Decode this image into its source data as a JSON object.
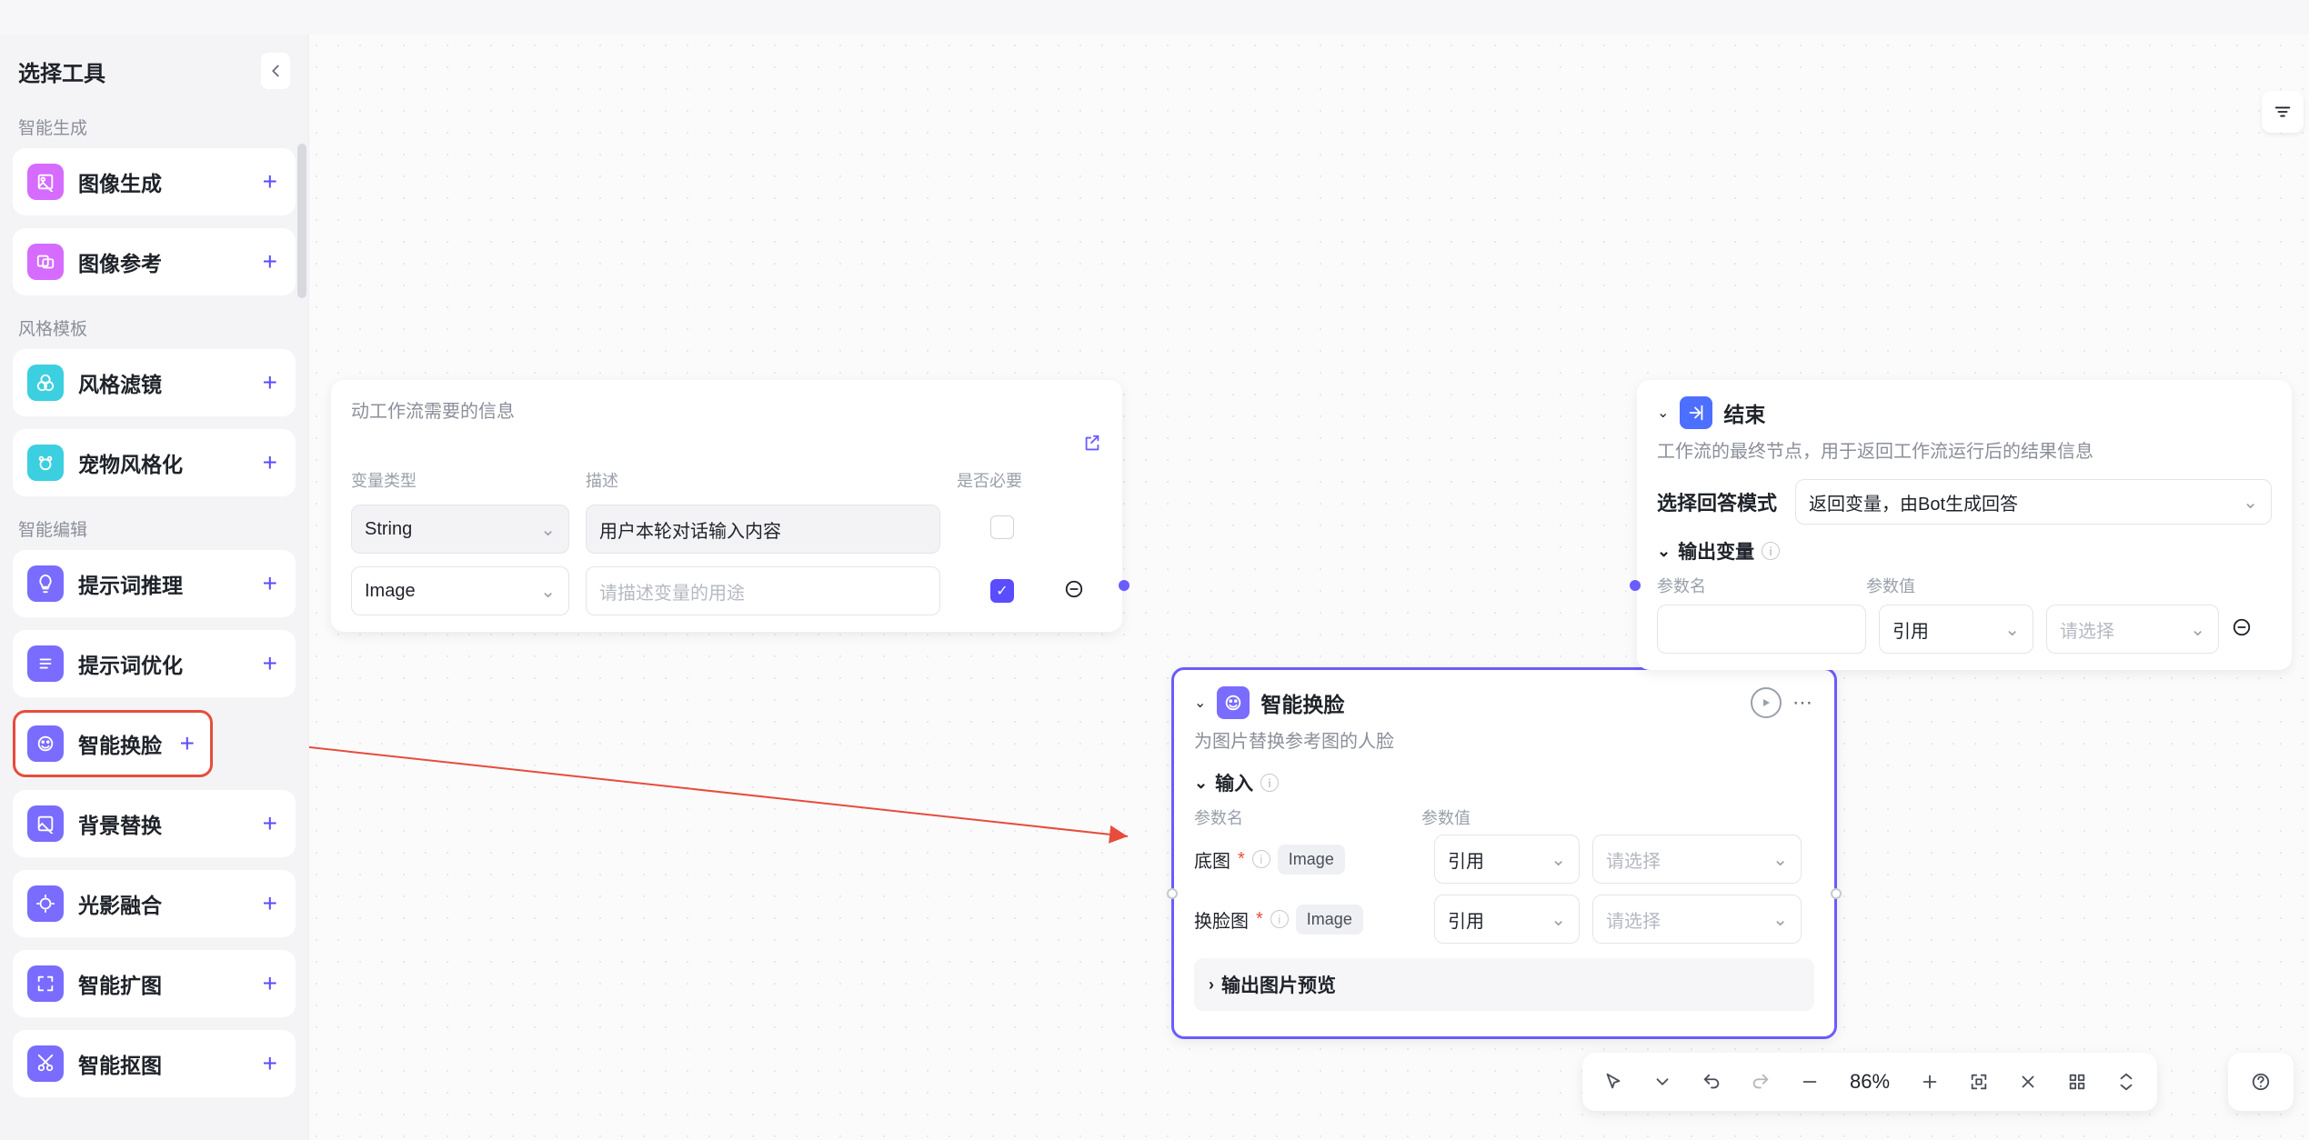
{
  "colors": {
    "accent": "#5a4cff",
    "danger": "#e74c3c"
  },
  "sidebar": {
    "title": "选择工具",
    "groups": [
      {
        "label": "智能生成",
        "items": [
          {
            "name": "image-gen",
            "label": "图像生成",
            "iconColor": "#d66bff"
          },
          {
            "name": "image-ref",
            "label": "图像参考",
            "iconColor": "#d66bff"
          }
        ]
      },
      {
        "label": "风格模板",
        "items": [
          {
            "name": "style-filter",
            "label": "风格滤镜",
            "iconColor": "#3bcfe0"
          },
          {
            "name": "pet-style",
            "label": "宠物风格化",
            "iconColor": "#3bcfe0"
          }
        ]
      },
      {
        "label": "智能编辑",
        "items": [
          {
            "name": "prompt-infer",
            "label": "提示词推理",
            "iconColor": "#7a6cff"
          },
          {
            "name": "prompt-opt",
            "label": "提示词优化",
            "iconColor": "#7a6cff"
          },
          {
            "name": "face-swap",
            "label": "智能换脸",
            "iconColor": "#7a6cff",
            "highlight": true
          },
          {
            "name": "bg-replace",
            "label": "背景替换",
            "iconColor": "#7a6cff"
          },
          {
            "name": "light-blend",
            "label": "光影融合",
            "iconColor": "#7a6cff"
          },
          {
            "name": "smart-expand",
            "label": "智能扩图",
            "iconColor": "#7a6cff"
          },
          {
            "name": "smart-cutout",
            "label": "智能抠图",
            "iconColor": "#7a6cff"
          }
        ]
      }
    ]
  },
  "startNode": {
    "desc": "动工作流需要的信息",
    "cols": {
      "type": "变量类型",
      "desc": "描述",
      "required": "是否必要"
    },
    "rows": [
      {
        "type": "String",
        "desc": "用户本轮对话输入内容",
        "required": false,
        "descIsValue": true
      },
      {
        "type": "Image",
        "descPlaceholder": "请描述变量的用途",
        "required": true
      }
    ]
  },
  "faceNode": {
    "title": "智能换脸",
    "desc": "为图片替换参考图的人脸",
    "inputSection": "输入",
    "cols": {
      "name": "参数名",
      "value": "参数值"
    },
    "params": [
      {
        "label": "底图",
        "required": true,
        "tag": "Image",
        "ref": "引用",
        "selectPlaceholder": "请选择"
      },
      {
        "label": "换脸图",
        "required": true,
        "tag": "Image",
        "ref": "引用",
        "selectPlaceholder": "请选择"
      }
    ],
    "outputSection": "输出图片预览"
  },
  "endNode": {
    "title": "结束",
    "desc": "工作流的最终节点，用于返回工作流运行后的结果信息",
    "modeLabel": "选择回答模式",
    "modeValue": "返回变量，由Bot生成回答",
    "outputSection": "输出变量",
    "cols": {
      "name": "参数名",
      "value": "参数值"
    },
    "row": {
      "ref": "引用",
      "selectPlaceholder": "请选择"
    }
  },
  "toolbar": {
    "zoom": "86%"
  }
}
